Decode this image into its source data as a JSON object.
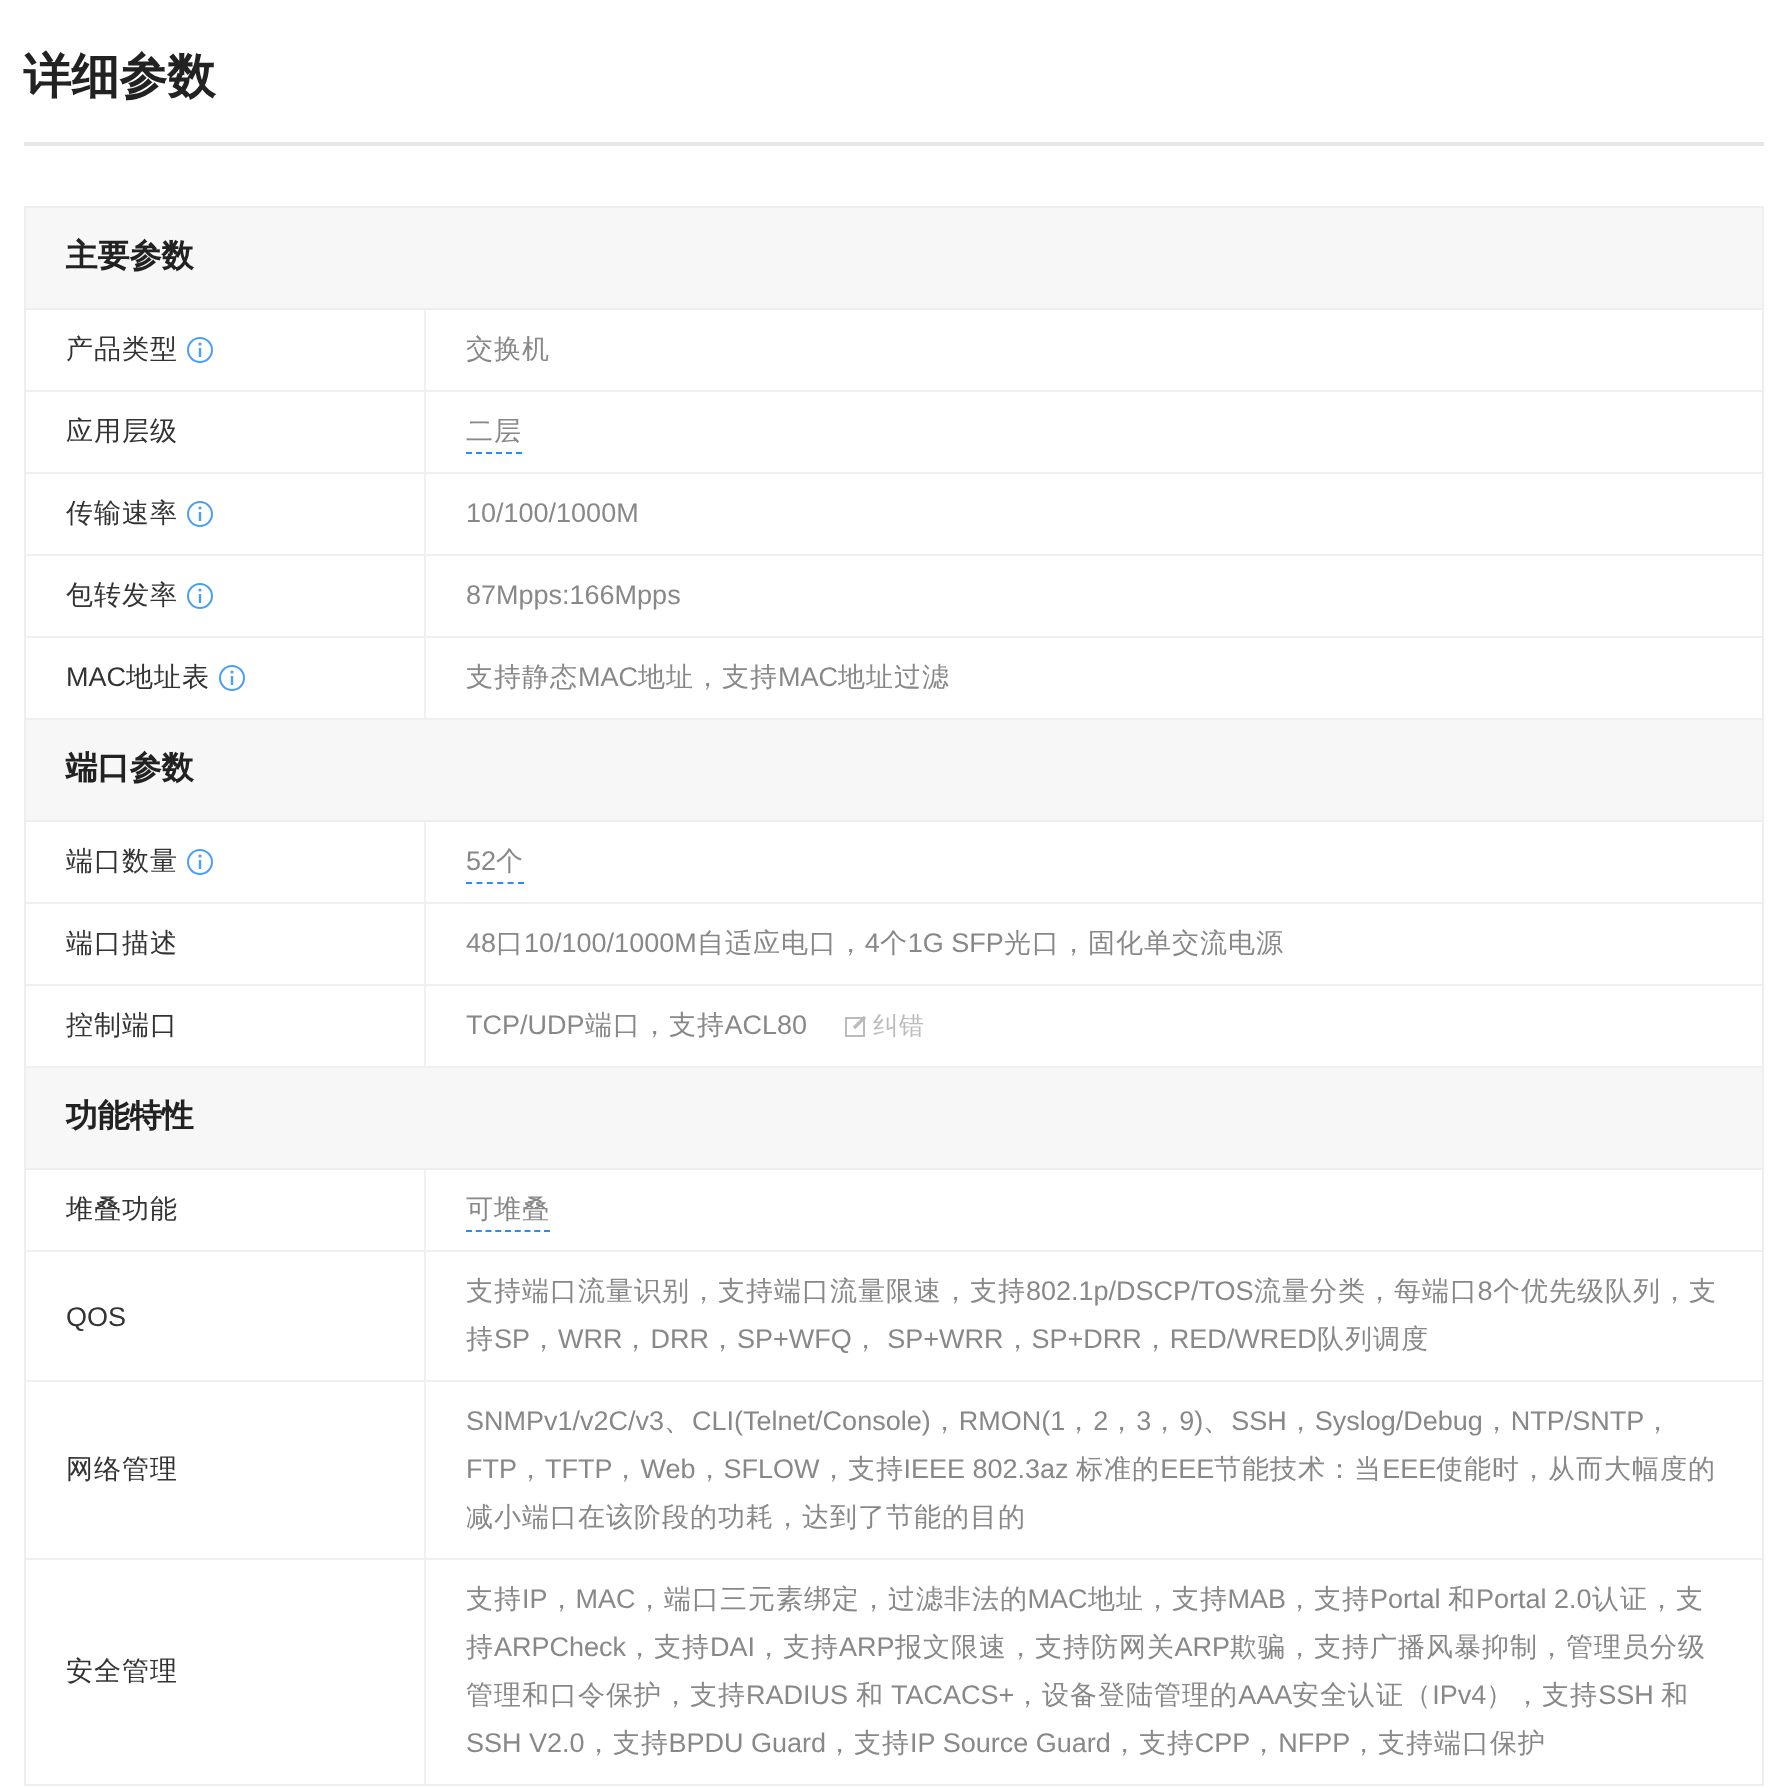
{
  "page_title": "详细参数",
  "sections": [
    {
      "title": "主要参数",
      "rows": [
        {
          "label": "产品类型",
          "info": true,
          "value": "交换机",
          "link": false
        },
        {
          "label": "应用层级",
          "info": false,
          "value": "二层",
          "link": true
        },
        {
          "label": "传输速率",
          "info": true,
          "value": "10/100/1000M",
          "link": false
        },
        {
          "label": "包转发率",
          "info": true,
          "value": "87Mpps:166Mpps",
          "link": false
        },
        {
          "label": "MAC地址表",
          "info": true,
          "value": "支持静态MAC地址，支持MAC地址过滤",
          "link": false
        }
      ]
    },
    {
      "title": "端口参数",
      "rows": [
        {
          "label": "端口数量",
          "info": true,
          "value": "52个",
          "link": true
        },
        {
          "label": "端口描述",
          "info": false,
          "value": "48口10/100/1000M自适应电口，4个1G SFP光口，固化单交流电源",
          "link": false
        },
        {
          "label": "控制端口",
          "info": false,
          "value": "TCP/UDP端口，支持ACL80",
          "link": false,
          "correction": "纠错"
        }
      ]
    },
    {
      "title": "功能特性",
      "rows": [
        {
          "label": "堆叠功能",
          "info": false,
          "value": "可堆叠",
          "link": true
        },
        {
          "label": "QOS",
          "info": false,
          "value": "支持端口流量识别，支持端口流量限速，支持802.1p/DSCP/TOS流量分类，每端口8个优先级队列，支持SP，WRR，DRR，SP+WFQ， SP+WRR，SP+DRR，RED/WRED队列调度",
          "link": false
        },
        {
          "label": "网络管理",
          "info": false,
          "value": "SNMPv1/v2C/v3、CLI(Telnet/Console)，RMON(1，2，3，9)、SSH，Syslog/Debug，NTP/SNTP，FTP，TFTP，Web，SFLOW，支持IEEE 802.3az 标准的EEE节能技术：当EEE使能时，从而大幅度的减小端口在该阶段的功耗，达到了节能的目的",
          "link": false
        },
        {
          "label": "安全管理",
          "info": false,
          "value": "支持IP，MAC，端口三元素绑定，过滤非法的MAC地址，支持MAB，支持Portal 和Portal 2.0认证，支持ARPCheck，支持DAI，支持ARP报文限速，支持防网关ARP欺骗，支持广播风暴抑制，管理员分级管理和口令保护，支持RADIUS 和 TACACS+，设备登陆管理的AAA安全认证（IPv4），支持SSH 和 SSH V2.0，支持BPDU Guard，支持IP Source Guard，支持CPP，NFPP，支持端口保护",
          "link": false
        }
      ]
    }
  ]
}
